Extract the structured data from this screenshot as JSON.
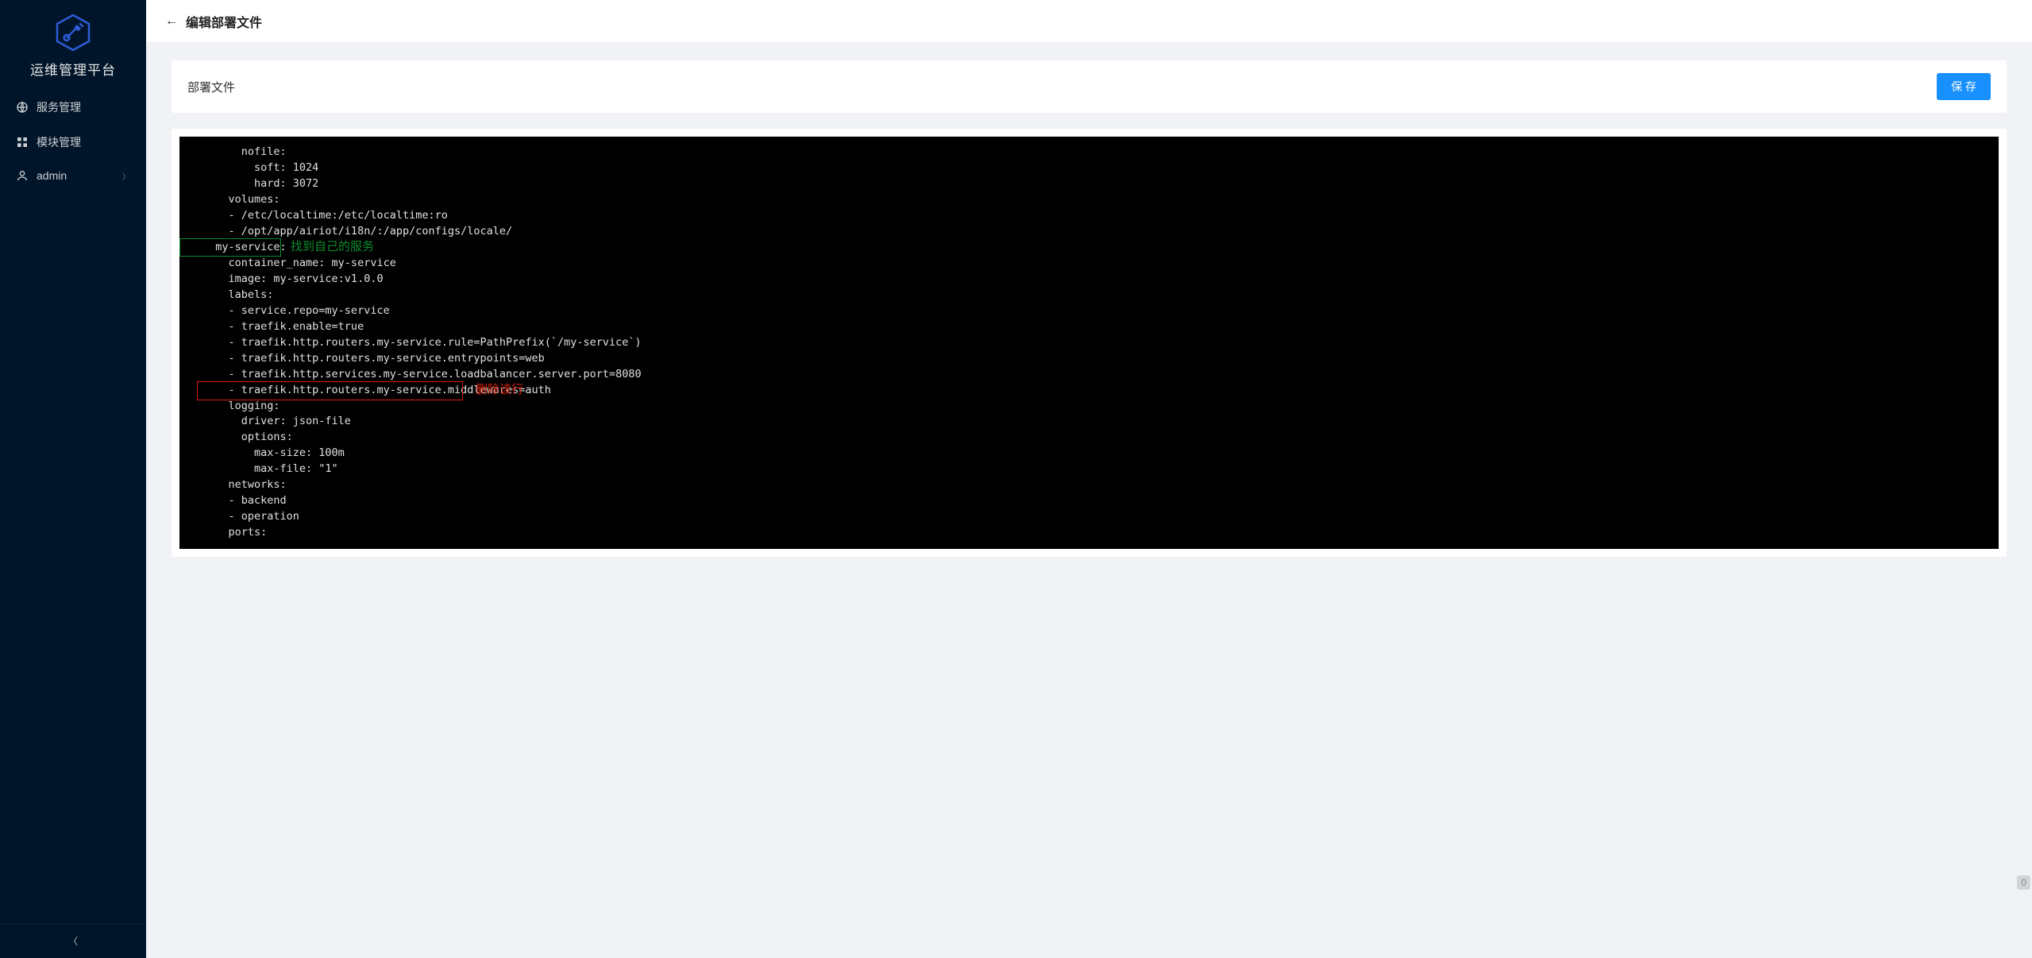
{
  "brand": "运维管理平台",
  "header": {
    "title": "编辑部署文件"
  },
  "sidebar": {
    "items": [
      {
        "label": "服务管理",
        "icon": "globe"
      },
      {
        "label": "模块管理",
        "icon": "grid"
      },
      {
        "label": "admin",
        "icon": "user",
        "has_arrow": true
      }
    ]
  },
  "card": {
    "title": "部署文件",
    "save_label": "保 存"
  },
  "editor": {
    "lines": [
      "      nofile:",
      "        soft: 1024",
      "        hard: 3072",
      "    volumes:",
      "    - /etc/localtime:/etc/localtime:ro",
      "    - /opt/app/airiot/i18n/:/app/configs/locale/",
      "  my-service:",
      "    container_name: my-service",
      "    image: my-service:v1.0.0",
      "    labels:",
      "    - service.repo=my-service",
      "    - traefik.enable=true",
      "    - traefik.http.routers.my-service.rule=PathPrefix(`/my-service`)",
      "    - traefik.http.routers.my-service.entrypoints=web",
      "    - traefik.http.services.my-service.loadbalancer.server.port=8080",
      "    - traefik.http.routers.my-service.middlewares=auth",
      "    logging:",
      "      driver: json-file",
      "      options:",
      "        max-size: 100m",
      "        max-file: \"1\"",
      "    networks:",
      "    - backend",
      "    - operation",
      "    ports:"
    ]
  },
  "annotations": {
    "green": {
      "text": "找到自己的服务",
      "line": 6
    },
    "red": {
      "text": "删除该行",
      "line": 15
    }
  },
  "page_indicator": "0"
}
